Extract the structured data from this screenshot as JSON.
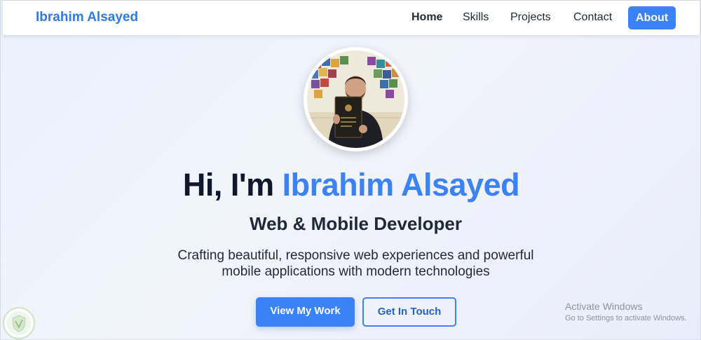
{
  "nav": {
    "brand": "Ibrahim Alsayed",
    "links": [
      "Home",
      "Skills",
      "Projects",
      "Contact"
    ],
    "about": "About"
  },
  "hero": {
    "greeting": "Hi, I'm ",
    "name": "Ibrahim Alsayed",
    "subtitle": "Web & Mobile Developer",
    "description": "Crafting beautiful, responsive web experiences and powerful mobile applications with modern technologies",
    "primary_button": "View My Work",
    "secondary_button": "Get In Touch"
  },
  "watermark": {
    "title": "Activate Windows",
    "subtitle": "Go to Settings to activate Windows."
  },
  "colors": {
    "accent": "#3b82f6",
    "brand": "#2f7ae5",
    "text": "#0f172a"
  }
}
